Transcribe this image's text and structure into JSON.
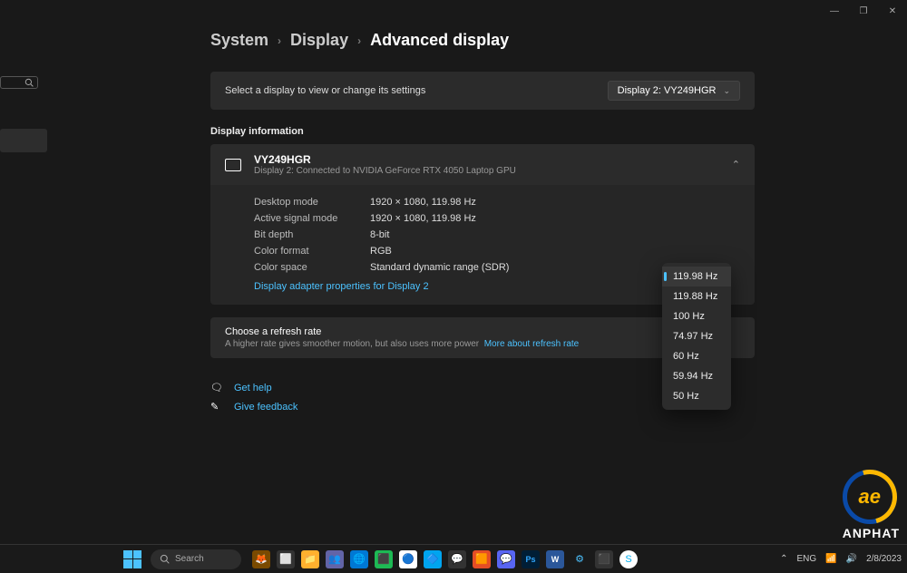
{
  "window": {
    "minimize": "—",
    "maximize": "❐",
    "close": "✕"
  },
  "breadcrumb": {
    "system": "System",
    "display": "Display",
    "advanced": "Advanced display"
  },
  "selector": {
    "label": "Select a display to view or change its settings",
    "value": "Display 2: VY249HGR"
  },
  "sections": {
    "display_info": "Display information"
  },
  "monitor": {
    "name": "VY249HGR",
    "sub": "Display 2: Connected to NVIDIA GeForce RTX 4050 Laptop GPU"
  },
  "info": [
    {
      "k": "Desktop mode",
      "v": "1920 × 1080, 119.98 Hz"
    },
    {
      "k": "Active signal mode",
      "v": "1920 × 1080, 119.98 Hz"
    },
    {
      "k": "Bit depth",
      "v": "8-bit"
    },
    {
      "k": "Color format",
      "v": "RGB"
    },
    {
      "k": "Color space",
      "v": "Standard dynamic range (SDR)"
    }
  ],
  "adapter_link": "Display adapter properties for Display 2",
  "refresh": {
    "title": "Choose a refresh rate",
    "sub": "A higher rate gives smoother motion, but also uses more power",
    "more": "More about refresh rate",
    "options": [
      "119.98 Hz",
      "119.88 Hz",
      "100 Hz",
      "74.97 Hz",
      "60 Hz",
      "59.94 Hz",
      "50 Hz"
    ],
    "selected": "119.98 Hz"
  },
  "help": {
    "get_help": "Get help",
    "feedback": "Give feedback"
  },
  "taskbar": {
    "search": "Search",
    "lang": "ENG",
    "date": "2/8/2023"
  },
  "watermark": {
    "brand": "ANPHAT",
    "logo": "ae"
  }
}
